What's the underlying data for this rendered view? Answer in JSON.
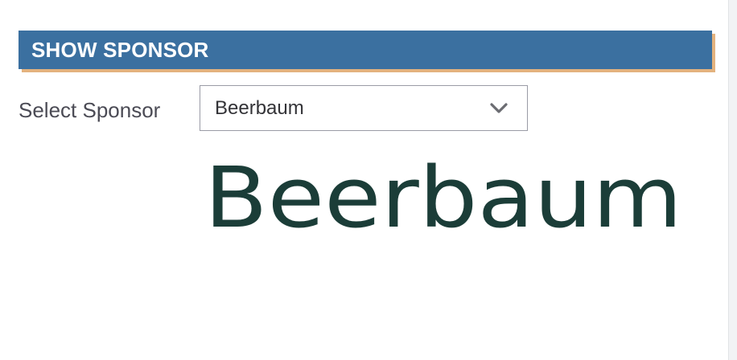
{
  "section": {
    "title": "SHOW SPONSOR"
  },
  "sponsor_select": {
    "label": "Select Sponsor",
    "selected": "Beerbaum"
  },
  "logo": {
    "text": "Beerbaum",
    "color": "#1b3d38"
  },
  "colors": {
    "header_bg": "#3b70a0",
    "header_accent": "#e3b27e",
    "header_text": "#ffffff"
  }
}
